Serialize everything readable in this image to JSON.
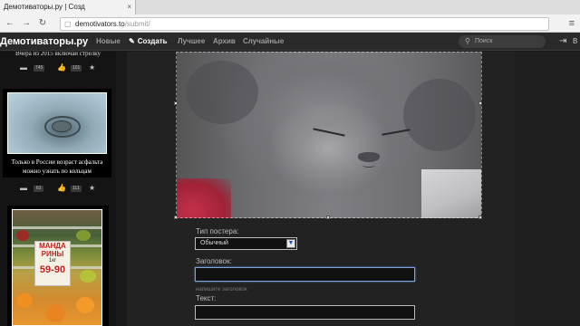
{
  "browser": {
    "tab_title": "Демотиваторы.ру | Созд",
    "tab_close": "×",
    "url_host": "demotivators.to",
    "url_path": "/submit/",
    "back": "←",
    "forward": "→",
    "reload": "↻",
    "menu": "≡"
  },
  "site": {
    "logo": "Демотиваторы.ру",
    "nav": {
      "new": "Новые",
      "create": "Создать",
      "best": "Лучшее",
      "archive": "Архив",
      "random": "Случайные"
    },
    "search_placeholder": "Поиск",
    "login": "В"
  },
  "feed": {
    "cut_caption": "Вчера из 2015 включай стрелку",
    "items": [
      {
        "comments": "745",
        "likes": "101",
        "caption": ""
      },
      {
        "comments": "63",
        "likes": "111",
        "caption": "Только в России возраст асфальта можно узнать по кольцам"
      },
      {
        "price_title": "МАНДА РИНЫ",
        "price_unit": "1кг",
        "price_value": "59-90"
      }
    ]
  },
  "form": {
    "poster_type_label": "Тип постера:",
    "poster_type_value": "Обычный",
    "title_label": "Заголовок:",
    "title_value": "",
    "title_hint": "напишите заголовок",
    "text_label": "Текст:",
    "text_value": ""
  },
  "colors": {
    "page_bg": "#1a1a1a",
    "header_bg": "#2a2a2a",
    "editor_bg": "#222222",
    "input_focus": "#7fa4d8"
  }
}
